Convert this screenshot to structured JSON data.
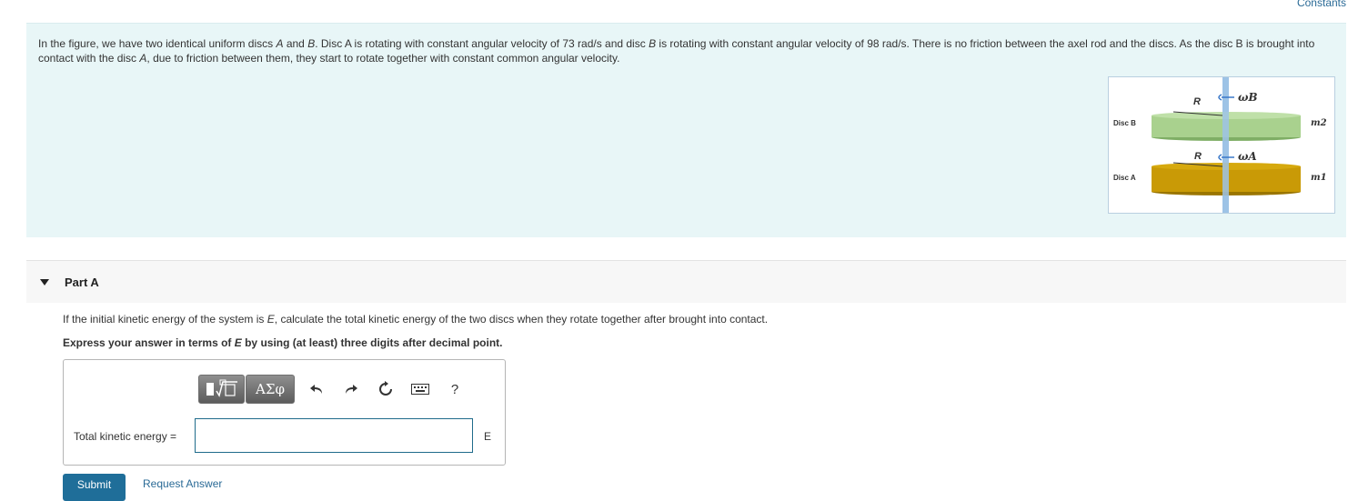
{
  "header": {
    "constants_link": "Constants"
  },
  "problem": {
    "t1": "In the figure, we have two identical uniform discs ",
    "disc_a": "A",
    "t2": " and ",
    "disc_b": "B",
    "t3": ". Disc A is rotating with constant angular velocity of 73 rad/s and disc ",
    "disc_b2": "B",
    "t4": " is rotating with constant angular velocity of 98 rad/s. There is no friction between the axel rod and the discs. As the disc B is brought into contact with the disc ",
    "disc_a2": "A",
    "t5": ", due to friction between them, they start to rotate together with constant common angular velocity."
  },
  "figure": {
    "disc_b_label": "Disc B",
    "disc_a_label": "Disc A",
    "r_top": "R",
    "r_bottom": "R",
    "omega_b": "ωB",
    "omega_a": "ωA",
    "m2": "m2",
    "m1": "m1",
    "colors": {
      "disc_b": "#a9d18e",
      "disc_a": "#c99a06",
      "axle": "#9dc3e6"
    }
  },
  "part": {
    "title": "Part A"
  },
  "question": {
    "text_before_e": "If the initial kinetic energy of the system is ",
    "e_symbol": "E",
    "text_after_e": ", calculate the total kinetic energy of the two discs when they rotate together after brought into contact.",
    "instr_before_e": "Express your answer in terms of ",
    "instr_e": "E",
    "instr_after_e": " by using (at least) three digits after decimal point."
  },
  "toolbar": {
    "templates_icon": "template-fraction-sqrt-icon",
    "greek_label": "ΑΣφ",
    "undo_icon": "undo-icon",
    "redo_icon": "redo-icon",
    "reset_icon": "reset-icon",
    "keyboard_icon": "keyboard-icon",
    "help_label": "?"
  },
  "answer": {
    "label": "Total kinetic energy =",
    "value": "",
    "unit": "E"
  },
  "actions": {
    "submit_label": "Submit",
    "request_label": "Request Answer"
  }
}
